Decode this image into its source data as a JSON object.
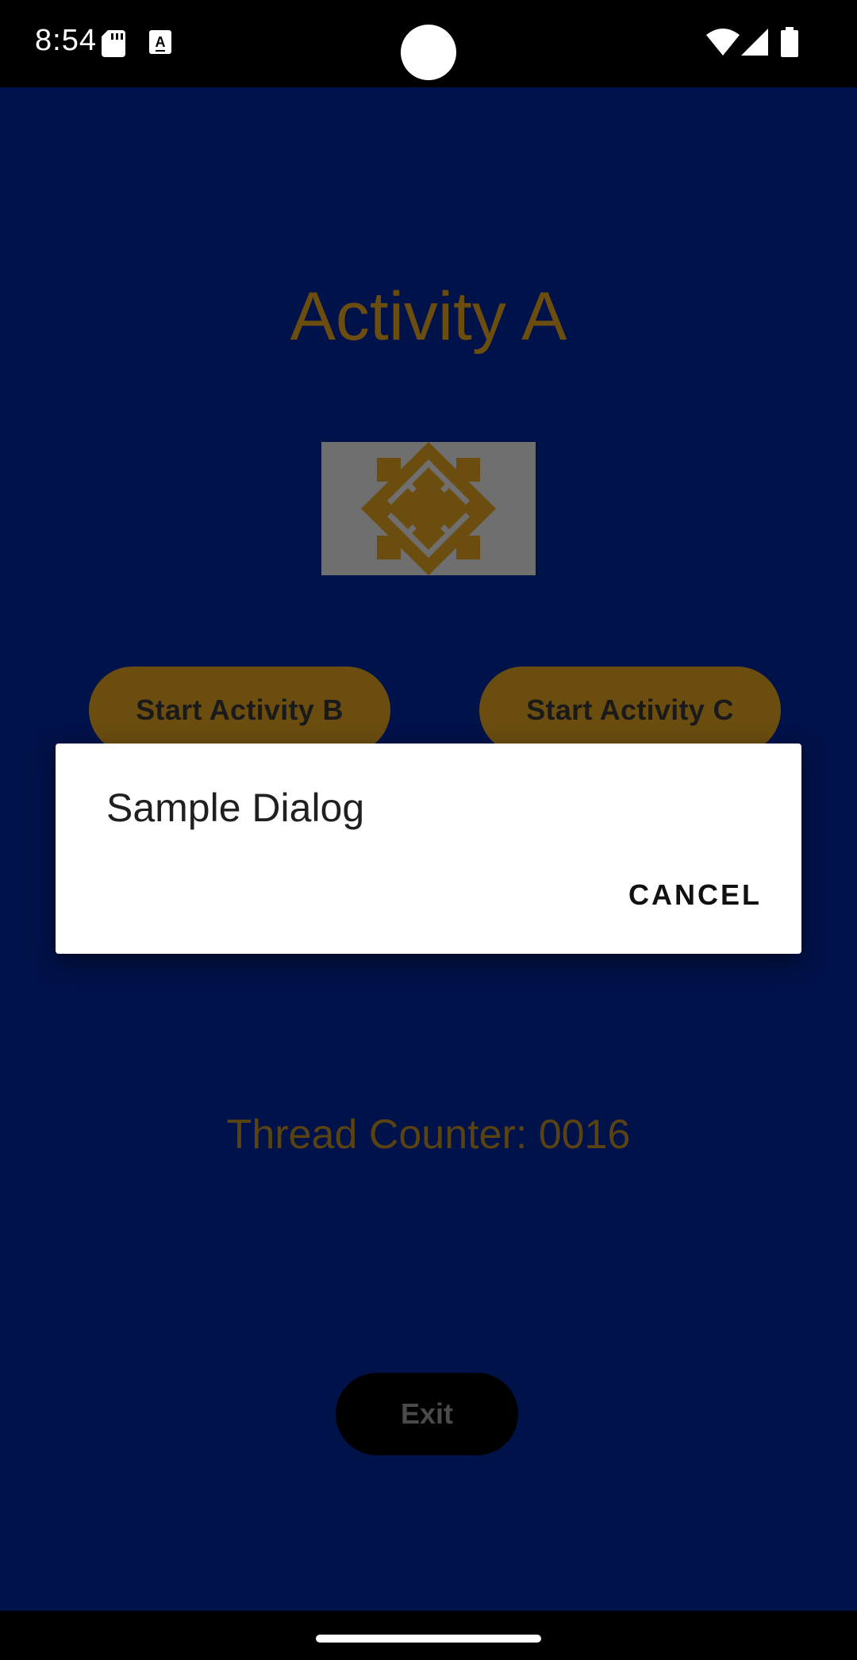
{
  "status_bar": {
    "time": "8:54",
    "icons": [
      "sd-card-icon",
      "keyboard-a-icon",
      "wifi-icon",
      "signal-icon",
      "battery-icon"
    ]
  },
  "app": {
    "title": "Activity A",
    "logo": "pattern-logo-icon",
    "buttons": {
      "start_b": "Start Activity B",
      "start_c": "Start Activity C",
      "exit": "Exit"
    },
    "thread_counter": "Thread Counter: 0016"
  },
  "dialog": {
    "title": "Sample Dialog",
    "cancel": "CANCEL"
  },
  "colors": {
    "background": "#00124a",
    "accent": "#6b4d10",
    "dialog_bg": "#ffffff"
  }
}
